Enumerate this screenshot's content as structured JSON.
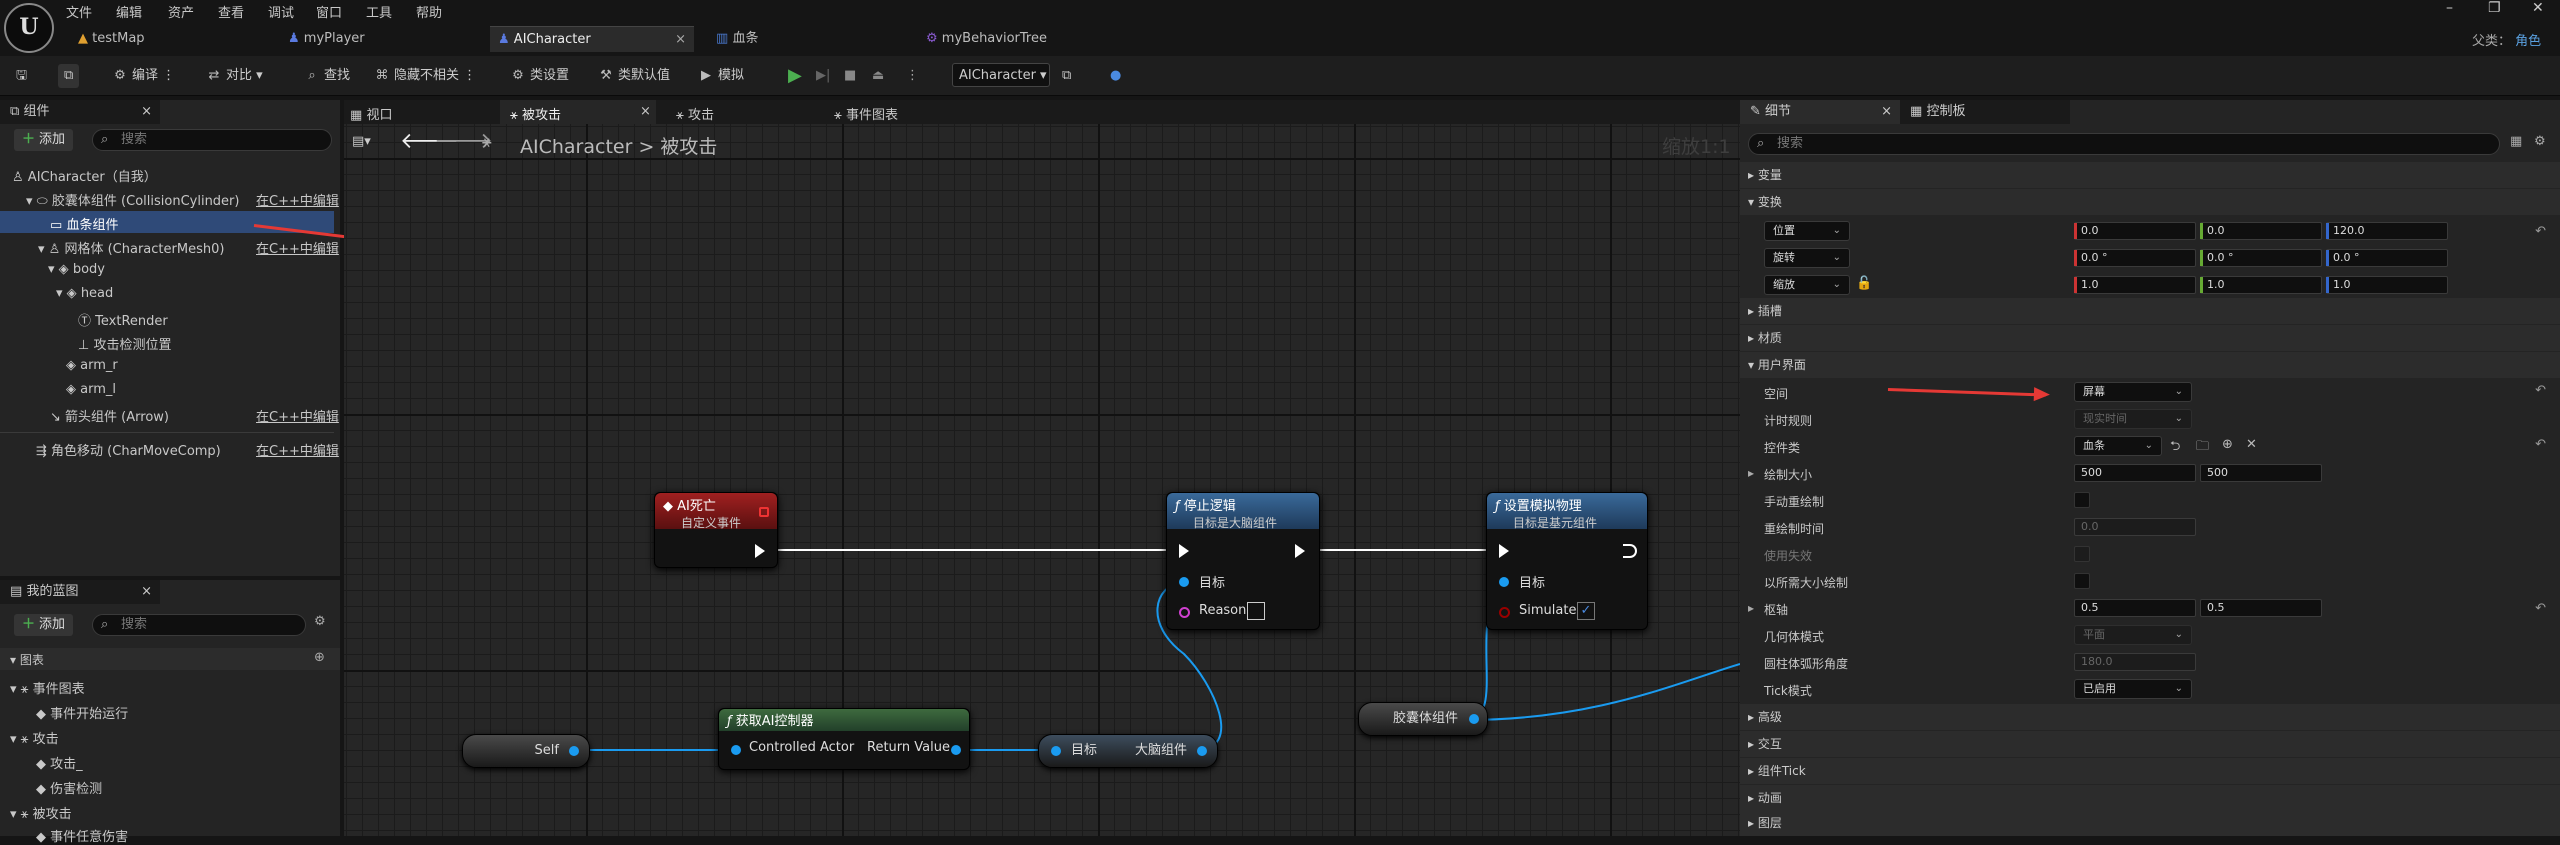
{
  "menu": [
    "文件",
    "编辑",
    "资产",
    "查看",
    "调试",
    "窗口",
    "工具",
    "帮助"
  ],
  "logo": "U",
  "tabs": [
    {
      "label": "testMap",
      "icon": "level-icon"
    },
    {
      "label": "myPlayer",
      "icon": "blueprint-icon"
    },
    {
      "label": "AICharacter",
      "icon": "blueprint-icon",
      "close": "×"
    },
    {
      "label": "血条",
      "icon": "widget-icon"
    },
    {
      "label": "myBehaviorTree",
      "icon": "behavior-tree-icon"
    }
  ],
  "parent": {
    "label": "父类：",
    "value": "角色"
  },
  "window_controls": [
    "–",
    "❐",
    "✕"
  ],
  "toolbar": {
    "compile": "编译",
    "diff": "对比",
    "find": "查找",
    "hide_unrelated": "隐藏不相关",
    "class_settings": "类设置",
    "class_defaults": "类默认值",
    "simulate": "模拟",
    "debug_object": "AICharacter"
  },
  "components_panel": {
    "title": "组件",
    "add": "添加",
    "search_placeholder": "搜索",
    "items": [
      {
        "label": "AICharacter（自我）"
      },
      {
        "label": "胶囊体组件 (CollisionCylinder)",
        "edit": "在C++中编辑"
      },
      {
        "label": "血条组件"
      },
      {
        "label": "网格体 (CharacterMesh0)",
        "edit": "在C++中编辑"
      },
      {
        "label": "body"
      },
      {
        "label": "head"
      },
      {
        "label": "TextRender"
      },
      {
        "label": "攻击检测位置"
      },
      {
        "label": "arm_r"
      },
      {
        "label": "arm_l"
      },
      {
        "label": "箭头组件 (Arrow)",
        "edit": "在C++中编辑"
      },
      {
        "label": "角色移动 (CharMoveComp)",
        "edit": "在C++中编辑"
      }
    ]
  },
  "my_blueprint_panel": {
    "title": "我的蓝图",
    "add": "添加",
    "search_placeholder": "搜索",
    "section": "图表",
    "items": [
      {
        "label": "事件图表",
        "level": 0
      },
      {
        "label": "事件开始运行",
        "level": 1
      },
      {
        "label": "攻击",
        "level": 0
      },
      {
        "label": "攻击_",
        "level": 1
      },
      {
        "label": "伤害检测",
        "level": 1
      },
      {
        "label": "被攻击",
        "level": 0
      },
      {
        "label": "事件任意伤害",
        "level": 1
      }
    ]
  },
  "graph_tabs": [
    "视口",
    "被攻击",
    "攻击",
    "事件图表"
  ],
  "graph": {
    "breadcrumb_root": "AICharacter",
    "breadcrumb_sep": ">",
    "breadcrumb_current": "被攻击",
    "zoom": "缩放1:1",
    "nodes": {
      "ai_death": {
        "title": "AI死亡",
        "subtitle": "自定义事件"
      },
      "stop_logic": {
        "title": "停止逻辑",
        "subtitle": "目标是大脑组件",
        "target": "目标",
        "reason": "Reason"
      },
      "set_sim": {
        "title": "设置模拟物理",
        "subtitle": "目标是基元组件",
        "target": "目标",
        "simulate": "Simulate"
      },
      "self": {
        "label": "Self"
      },
      "get_ai": {
        "title": "获取AI控制器",
        "in": "Controlled Actor",
        "out": "Return Value"
      },
      "brain": {
        "in": "目标",
        "out": "大脑组件"
      },
      "capsule": {
        "label": "胶囊体组件"
      }
    }
  },
  "details_panel": {
    "title": "细节",
    "tab2": "控制板",
    "search_placeholder": "搜索",
    "sections": {
      "variables": "变量",
      "transform": "变换",
      "sockets": "插槽",
      "materials": "材质",
      "ui": "用户界面",
      "advanced": "高级",
      "interaction": "交互",
      "component_tick": "组件Tick",
      "animation": "动画",
      "layers": "图层"
    },
    "transform": [
      {
        "label": "位置",
        "x": "0.0",
        "y": "0.0",
        "z": "120.0"
      },
      {
        "label": "旋转",
        "x": "0.0 °",
        "y": "0.0 °",
        "z": "0.0 °"
      },
      {
        "label": "缩放",
        "x": "1.0",
        "y": "1.0",
        "z": "1.0"
      }
    ],
    "ui": {
      "space": {
        "label": "空间",
        "value": "屏幕"
      },
      "timing": {
        "label": "计时规则",
        "value": "现实时间"
      },
      "widget_class": {
        "label": "控件类",
        "value": "血条"
      },
      "draw_size": {
        "label": "绘制大小",
        "x": "500",
        "y": "500"
      },
      "manual_redraw": {
        "label": "手动重绘制"
      },
      "redraw_time": {
        "label": "重绘制时间",
        "value": "0.0"
      },
      "use_invalidation": {
        "label": "使用失效"
      },
      "draw_at_desired": {
        "label": "以所需大小绘制"
      },
      "pivot": {
        "label": "枢轴",
        "x": "0.5",
        "y": "0.5"
      },
      "geometry_mode": {
        "label": "几何体模式",
        "value": "平面"
      },
      "cylinder_arc": {
        "label": "圆柱体弧形角度",
        "value": "180.0"
      },
      "tick_mode": {
        "label": "Tick模式",
        "value": "已启用"
      }
    }
  },
  "colors": {
    "exec": "#ffffff",
    "object_pin": "#1a9bf0",
    "annotation_arrow": "#e53935",
    "selected": "#2f4a78"
  }
}
